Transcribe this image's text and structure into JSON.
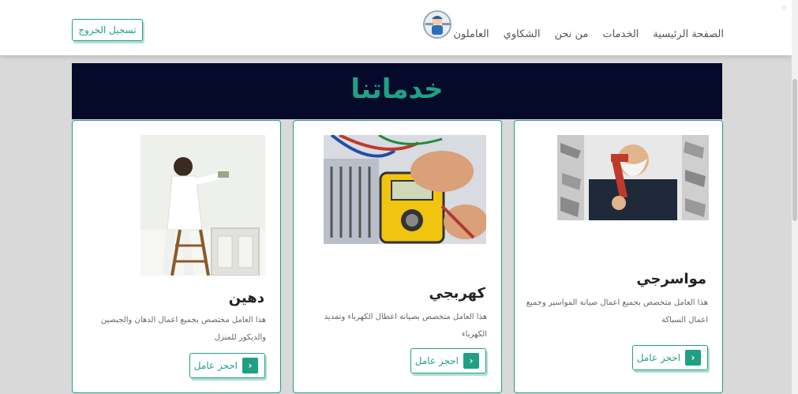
{
  "nav": {
    "items": [
      "الصفحة الرئيسية",
      "الخدمات",
      "من نحن",
      "الشكاوي",
      "العاملون"
    ],
    "logout_label": "تسجيل الخروج"
  },
  "banner": {
    "title": "خدماتنا"
  },
  "cards": [
    {
      "title": "مواسرجي",
      "description": "هذا العامل متخصص بجميع اعمال صيانة المواسير وجميع اعمال السباكة",
      "button": "احجز عامل",
      "image_icon": "plumber-photo"
    },
    {
      "title": "كهربجي",
      "description": "هذا العامل متخصص بصيانة اعطال الكهرباء وتمديد الكهرباء",
      "button": "احجز عامل",
      "image_icon": "electrician-photo"
    },
    {
      "title": "دهين",
      "description": "هذا العامل مختصص بجميع اعمال الدهان والجبصين والديكور للمنزل",
      "button": "احجز عامل",
      "image_icon": "painter-photo"
    }
  ],
  "colors": {
    "accent": "#1fa085",
    "banner_bg": "#050a2b",
    "page_bg": "#d9d9d9"
  }
}
